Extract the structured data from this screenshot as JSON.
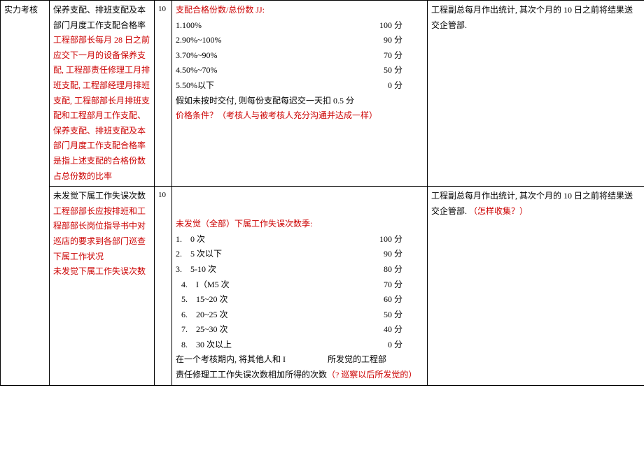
{
  "row1": {
    "col1": "实力考核",
    "col2_black": "保养支配、排班支配及本部门月度工作支配合格率",
    "col2_red": "工程部部长每月 28 日之前应交下一月的设备保养支配, 工程部责任修理工月排班支配, 工程部经理月排班支配, 工程部部长月排班支配和工程部月工作支配、保养支配、排班支配及本部门月度工作支配合格率是指上述支配的合格份数占总份数的比率",
    "col3": "10",
    "col4_title_red": "支配合格份数/总份数 JJ:",
    "col4_scores": [
      {
        "label": "1.100%",
        "val": "100 分"
      },
      {
        "label": "2.90%~100%",
        "val": "90 分"
      },
      {
        "label": "3.70%~90%",
        "val": "70 分"
      },
      {
        "label": "4.50%~70%",
        "val": "50 分"
      },
      {
        "label": "5.50%以下",
        "val": "0 分"
      }
    ],
    "col4_note": "假如未按时交付, 则每份支配每迟交一天扣 0.5 分",
    "col4_red2": "价格条件？（考核人与被考核人充分沟通并达成一样）",
    "col5": "工程副总每月作出统计, 其次个月的 10 日之前将结果送交企管部."
  },
  "row2": {
    "col2_black": "未发觉下属工作失误次数",
    "col2_red": "工程部部长应按排班和工程部部长岗位指导书中对巡店的要求到各部门巡查下属工作状况",
    "col2_red2": "未发觉下属工作失误次数",
    "col3": "10",
    "col4_title_red": "未发觉（全部）下属工作失误次数季:",
    "col4_scores": [
      {
        "label": "1.　0 次",
        "val": "100 分"
      },
      {
        "label": "2.　5 次以下",
        "val": "90 分"
      },
      {
        "label": "3.　5-10 次",
        "val": "80 分"
      },
      {
        "label": "4.　I（M5 次",
        "val": "70 分"
      },
      {
        "label": "5.　15~20 次",
        "val": "60 分"
      },
      {
        "label": "6.　20~25 次",
        "val": "50 分"
      },
      {
        "label": "7.　25~30 次",
        "val": "40 分"
      },
      {
        "label": "8.　30 次以上",
        "val": "0 分"
      }
    ],
    "col4_note1": "在一个考核期内, 将其他人和 I　　　　　所发觉的工程部",
    "col4_note2a": "责任修理工工作失误次数相加所得的次数",
    "col4_note2b": "（? 巡察以后所发觉的）",
    "col5a": "工程副总每月作出统计, 其次个月的 10 日之前将结果送交企管部. ",
    "col5b": "（怎样收集？）"
  }
}
